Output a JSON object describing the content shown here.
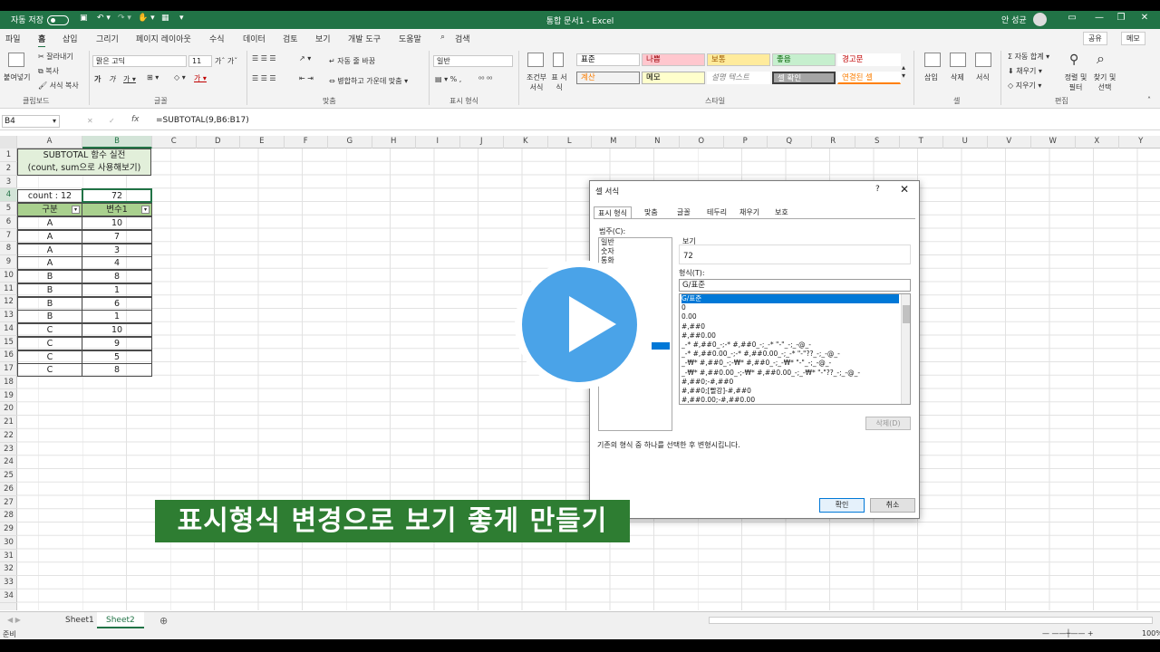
{
  "window": {
    "autosave_label": "자동 저장",
    "title": "통합 문서1 - Excel",
    "user": "안 성균",
    "controls": [
      "—",
      "❐",
      "✕"
    ]
  },
  "ribbon_tabs": [
    "파일",
    "홈",
    "삽입",
    "그리기",
    "페이지 레이아웃",
    "수식",
    "데이터",
    "검토",
    "보기",
    "개발 도구",
    "도움말",
    "검색"
  ],
  "active_tab": "홈",
  "share_label": "공유",
  "memo_label": "메모",
  "ribbon": {
    "clipboard": {
      "paste": "붙여넣기",
      "cut": "잘라내기",
      "copy": "복사",
      "format_painter": "서식 복사",
      "label": "클립보드"
    },
    "font": {
      "name": "맑은 고딕",
      "size": "11",
      "label": "글꼴"
    },
    "alignment": {
      "wrap": "자동 줄 바꿈",
      "merge": "병합하고 가운데 맞춤",
      "label": "맞춤"
    },
    "number": {
      "format": "일반",
      "label": "표시 형식"
    },
    "styles": {
      "conditional": "조건부 서식",
      "table": "표 서식",
      "cells": [
        {
          "text": "표준",
          "bg": "#ffffff",
          "color": "#000000"
        },
        {
          "text": "나쁨",
          "bg": "#ffc7ce",
          "color": "#9c0006"
        },
        {
          "text": "보통",
          "bg": "#ffeb9c",
          "color": "#9c5700"
        },
        {
          "text": "좋음",
          "bg": "#c6efce",
          "color": "#006100"
        },
        {
          "text": "경고문",
          "bg": "#ffffff",
          "color": "#c00000"
        },
        {
          "text": "계산",
          "bg": "#f2f2f2",
          "color": "#fa7d00"
        },
        {
          "text": "메모",
          "bg": "#ffffcc",
          "color": "#000000"
        },
        {
          "text": "설명 텍스트",
          "bg": "#ffffff",
          "color": "#7f7f7f"
        },
        {
          "text": "셀 확인",
          "bg": "#a5a5a5",
          "color": "#ffffff"
        },
        {
          "text": "연결된 셀",
          "bg": "#ffffff",
          "color": "#fa7d00"
        }
      ],
      "label": "스타일"
    },
    "cells": {
      "insert": "삽입",
      "delete": "삭제",
      "format": "서식",
      "label": "셀"
    },
    "editing": {
      "autosum": "자동 합계",
      "fill": "채우기",
      "clear": "지우기",
      "sort": "정렬 및 필터",
      "find": "찾기 및 선택",
      "label": "편집"
    }
  },
  "formula_bar": {
    "name_box": "B4",
    "fx": "fx",
    "formula": "=SUBTOTAL(9,B6:B17)"
  },
  "columns": [
    "A",
    "B",
    "C",
    "D",
    "E",
    "F",
    "G",
    "H",
    "I",
    "J",
    "K",
    "L",
    "M",
    "N",
    "O",
    "P",
    "Q",
    "R",
    "S",
    "T",
    "U",
    "V",
    "W",
    "X",
    "Y"
  ],
  "rows": [
    "1",
    "2",
    "3",
    "4",
    "5",
    "6",
    "7",
    "8",
    "9",
    "10",
    "11",
    "12",
    "13",
    "14",
    "15",
    "16",
    "17",
    "18",
    "19",
    "20",
    "21",
    "22",
    "23",
    "24",
    "25",
    "26",
    "27",
    "28",
    "29",
    "30",
    "31",
    "32",
    "33",
    "34"
  ],
  "sheet": {
    "title_line1": "SUBTOTAL 함수 실전",
    "title_line2": "(count, sum으로 사용해보기)",
    "count_label": "count : 12",
    "count_value": "72",
    "headers": [
      "구분",
      "변수1"
    ],
    "data": [
      [
        "A",
        "10"
      ],
      [
        "A",
        "7"
      ],
      [
        "A",
        "3"
      ],
      [
        "A",
        "4"
      ],
      [
        "B",
        "8"
      ],
      [
        "B",
        "1"
      ],
      [
        "B",
        "6"
      ],
      [
        "B",
        "1"
      ],
      [
        "C",
        "10"
      ],
      [
        "C",
        "9"
      ],
      [
        "C",
        "5"
      ],
      [
        "C",
        "8"
      ]
    ]
  },
  "sheet_tabs": [
    "Sheet1",
    "Sheet2"
  ],
  "active_sheet": "Sheet2",
  "status": {
    "mode": "준비",
    "zoom": "100%"
  },
  "dialog": {
    "title": "셀 서식",
    "help": "?",
    "close": "✕",
    "tabs": [
      "표시 형식",
      "맞춤",
      "글꼴",
      "테두리",
      "채우기",
      "보호"
    ],
    "category_label": "범주(C):",
    "categories": [
      "일반",
      "숫자",
      "통화"
    ],
    "sample_label": "보기",
    "sample_value": "72",
    "type_label": "형식(T):",
    "type_value": "G/표준",
    "type_items": [
      "G/표준",
      "0",
      "0.00",
      "#,##0",
      "#,##0.00",
      "_-* #,##0_-;-* #,##0_-;_-* \"-\"_-;_-@_-",
      "_-* #,##0.00_-;-* #,##0.00_-;_-* \"-\"??_-;_-@_-",
      "_-₩* #,##0_-;-₩* #,##0_-;_-₩* \"-\"_-;_-@_-",
      "_-₩* #,##0.00_-;-₩* #,##0.00_-;_-₩* \"-\"??_-;_-@_-",
      "#,##0;-#,##0",
      "#,##0;[빨강]-#,##0",
      "#,##0.00;-#,##0.00"
    ],
    "delete_label": "삭제(D)",
    "description": "기존의 형식 중 하나를 선택한 후 변형시킵니다.",
    "ok_label": "확인",
    "cancel_label": "취소"
  },
  "caption": "표시형식 변경으로 보기 좋게 만들기",
  "accent_color": "#217346"
}
